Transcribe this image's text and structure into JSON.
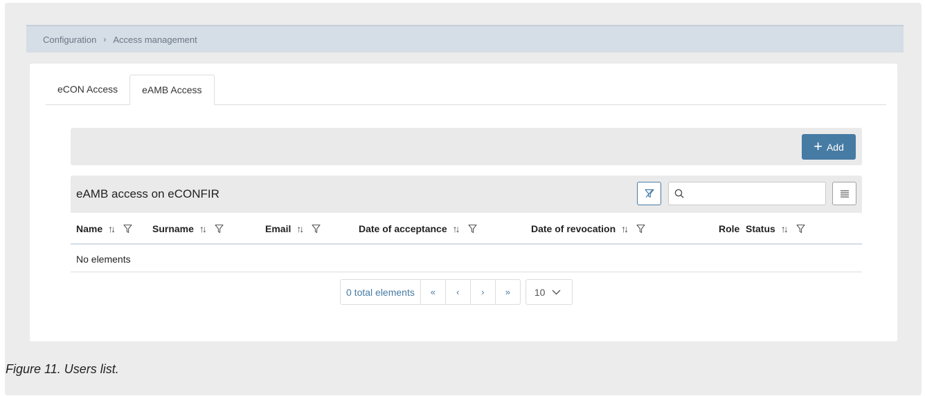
{
  "breadcrumb": {
    "items": [
      "Configuration",
      "Access management"
    ],
    "separator": "›"
  },
  "tabs": [
    {
      "label": "eCON Access",
      "active": false
    },
    {
      "label": "eAMB Access",
      "active": true
    }
  ],
  "toolbar": {
    "add_label": "Add",
    "accent_color": "#467ba4"
  },
  "table": {
    "title": "eAMB access on eCONFIR",
    "search": {
      "value": "",
      "placeholder": ""
    },
    "columns": [
      {
        "label": "Name",
        "sortable": true,
        "filterable": true
      },
      {
        "label": "Surname",
        "sortable": true,
        "filterable": true
      },
      {
        "label": "Email",
        "sortable": true,
        "filterable": true
      },
      {
        "label": "Date of acceptance",
        "sortable": true,
        "filterable": true
      },
      {
        "label": "Date of revocation",
        "sortable": true,
        "filterable": true
      },
      {
        "label": "Role",
        "sortable": false,
        "filterable": false
      },
      {
        "label": "Status",
        "sortable": true,
        "filterable": true
      }
    ],
    "empty_message": "No elements"
  },
  "pagination": {
    "total_label": "0 total elements",
    "first": "«",
    "prev": "‹",
    "next": "›",
    "last": "»",
    "page_size": "10"
  },
  "caption": "Figure 11. Users list."
}
